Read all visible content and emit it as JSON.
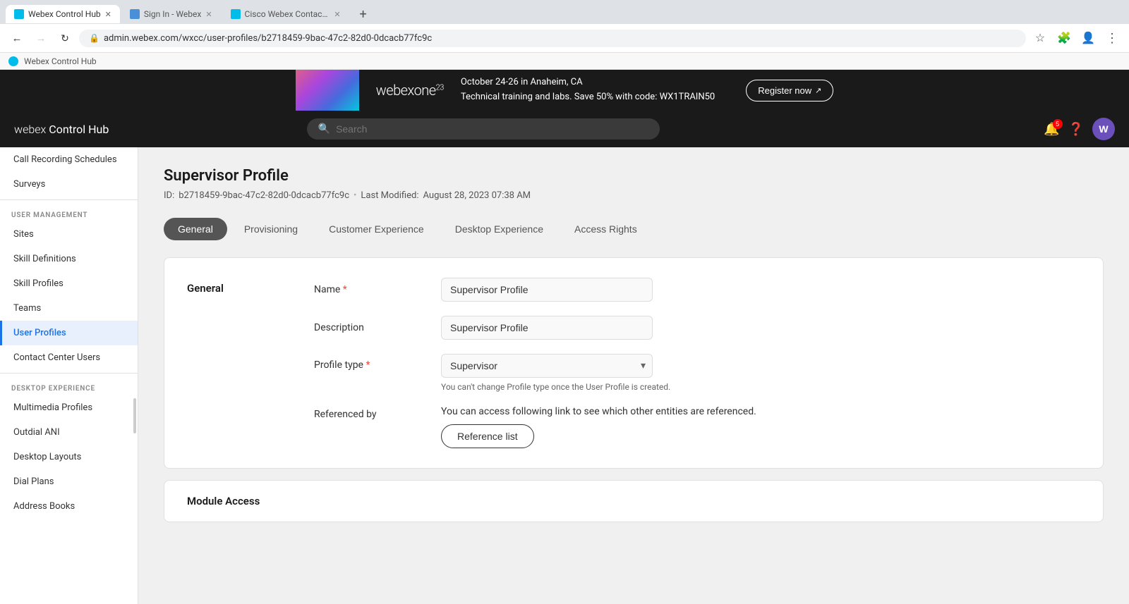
{
  "browser": {
    "tabs": [
      {
        "id": "tab1",
        "favicon_color": "#00bceb",
        "title": "Webex Control Hub",
        "active": true
      },
      {
        "id": "tab2",
        "favicon_color": "#4a90d9",
        "title": "Sign In - Webex",
        "active": false
      },
      {
        "id": "tab3",
        "favicon_color": "#00bceb",
        "title": "Cisco Webex Contact Center...",
        "active": false
      }
    ],
    "url": "admin.webex.com/wxcc/user-profiles/b2718459-9bac-47c2-82d0-0dcacb77fc9c",
    "back_disabled": false,
    "forward_disabled": true
  },
  "app_header": {
    "favicon_label": "webex-favicon",
    "title": "Webex Control Hub"
  },
  "banner": {
    "logo": "webexone",
    "logo_superscript": "23",
    "line1": "October 24-26 in Anaheim, CA",
    "line2": "Technical training and labs. Save 50% with code: WX1TRAIN50",
    "register_btn": "Register now"
  },
  "nav": {
    "logo_webex": "webex",
    "logo_hub": "Control Hub",
    "search_placeholder": "Search",
    "notification_count": "5",
    "avatar_letter": "W"
  },
  "sidebar": {
    "sections": [
      {
        "id": "section-upper",
        "items": [
          {
            "id": "call-recording",
            "label": "Call Recording Schedules",
            "active": false
          },
          {
            "id": "surveys",
            "label": "Surveys",
            "active": false
          }
        ]
      },
      {
        "id": "section-user-management",
        "label": "USER MANAGEMENT",
        "items": [
          {
            "id": "sites",
            "label": "Sites",
            "active": false
          },
          {
            "id": "skill-definitions",
            "label": "Skill Definitions",
            "active": false
          },
          {
            "id": "skill-profiles",
            "label": "Skill Profiles",
            "active": false
          },
          {
            "id": "teams",
            "label": "Teams",
            "active": false
          },
          {
            "id": "user-profiles",
            "label": "User Profiles",
            "active": true
          },
          {
            "id": "contact-center-users",
            "label": "Contact Center Users",
            "active": false
          }
        ]
      },
      {
        "id": "section-desktop-experience",
        "label": "DESKTOP EXPERIENCE",
        "items": [
          {
            "id": "multimedia-profiles",
            "label": "Multimedia Profiles",
            "active": false
          },
          {
            "id": "outdial-ani",
            "label": "Outdial ANI",
            "active": false
          },
          {
            "id": "desktop-layouts",
            "label": "Desktop Layouts",
            "active": false
          },
          {
            "id": "dial-plans",
            "label": "Dial Plans",
            "active": false
          },
          {
            "id": "address-books",
            "label": "Address Books",
            "active": false
          }
        ]
      }
    ]
  },
  "page": {
    "title": "Supervisor Profile",
    "id_label": "ID:",
    "id_value": "b2718459-9bac-47c2-82d0-0dcacb77fc9c",
    "last_modified_label": "Last Modified:",
    "last_modified_value": "August 28, 2023 07:38 AM",
    "tabs": [
      {
        "id": "general",
        "label": "General",
        "active": true
      },
      {
        "id": "provisioning",
        "label": "Provisioning",
        "active": false
      },
      {
        "id": "customer-experience",
        "label": "Customer Experience",
        "active": false
      },
      {
        "id": "desktop-experience",
        "label": "Desktop Experience",
        "active": false
      },
      {
        "id": "access-rights",
        "label": "Access Rights",
        "active": false
      }
    ],
    "form": {
      "section_title": "General",
      "fields": [
        {
          "id": "name",
          "label": "Name",
          "required": true,
          "type": "text",
          "value": "Supervisor Profile"
        },
        {
          "id": "description",
          "label": "Description",
          "required": false,
          "type": "text",
          "value": "Supervisor Profile"
        },
        {
          "id": "profile-type",
          "label": "Profile type",
          "required": true,
          "type": "select",
          "value": "Supervisor",
          "hint": "You can't change Profile type once the User Profile is created."
        },
        {
          "id": "referenced-by",
          "label": "Referenced by",
          "required": false,
          "type": "referenced",
          "text": "You can access following link to see which other entities are referenced.",
          "button_label": "Reference list"
        }
      ]
    }
  }
}
